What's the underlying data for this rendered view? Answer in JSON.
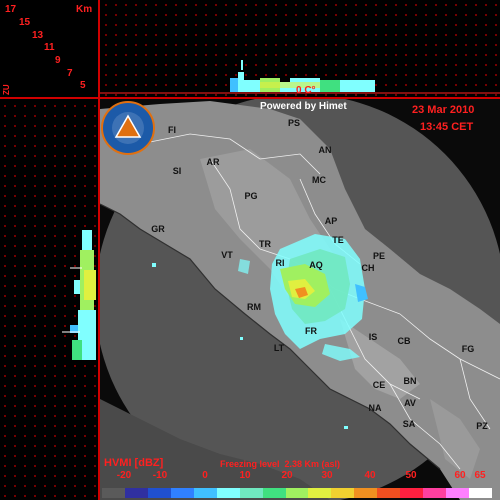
{
  "header": {
    "powered_by": "Powered by Himet",
    "date": "23 Mar 2010",
    "time": "13:45 CET"
  },
  "logo": {
    "name": "regional-civil-protection-logo",
    "primary_color": "#1c5aa8",
    "accent_color": "#e07010"
  },
  "top_profile": {
    "distance_labels": [
      "17",
      "15",
      "13",
      "11",
      "9",
      "7",
      "5"
    ],
    "unit": "Km",
    "freezing_marker": "0 C°",
    "side_label": "ZU"
  },
  "legend": {
    "product": "HVMI [dBZ]",
    "freezing_level_text": "Freezing level  2.38 Km (asl)",
    "ticks": [
      "-20",
      "-10",
      "0",
      "10",
      "20",
      "30",
      "40",
      "50",
      "60",
      "65"
    ],
    "colors": [
      "#5a5a5a",
      "#3030a0",
      "#2050d0",
      "#3080ff",
      "#40c0ff",
      "#80ffff",
      "#70e8c0",
      "#40e080",
      "#a0f060",
      "#e0f040",
      "#f0d030",
      "#f09020",
      "#f05020",
      "#ff2040",
      "#ff40a0",
      "#ff80ff",
      "#ffffff"
    ]
  },
  "cities": [
    {
      "name": "PS"
    },
    {
      "name": "FI"
    },
    {
      "name": "AN"
    },
    {
      "name": "SI"
    },
    {
      "name": "AR"
    },
    {
      "name": "MC"
    },
    {
      "name": "PG"
    },
    {
      "name": "GR"
    },
    {
      "name": "AP"
    },
    {
      "name": "TE"
    },
    {
      "name": "VT"
    },
    {
      "name": "TR"
    },
    {
      "name": "RI"
    },
    {
      "name": "AQ"
    },
    {
      "name": "PE"
    },
    {
      "name": "CH"
    },
    {
      "name": "RM"
    },
    {
      "name": "FR"
    },
    {
      "name": "IS"
    },
    {
      "name": "CB"
    },
    {
      "name": "FG"
    },
    {
      "name": "LT"
    },
    {
      "name": "CE"
    },
    {
      "name": "BN"
    },
    {
      "name": "NA"
    },
    {
      "name": "AV"
    },
    {
      "name": "SA"
    },
    {
      "name": "PZ"
    }
  ],
  "colors": {
    "background": "#000000",
    "grid": "#8b0000",
    "label": "#ff2020",
    "land": "#8a8a8a",
    "sea": "#5a5a5a"
  }
}
